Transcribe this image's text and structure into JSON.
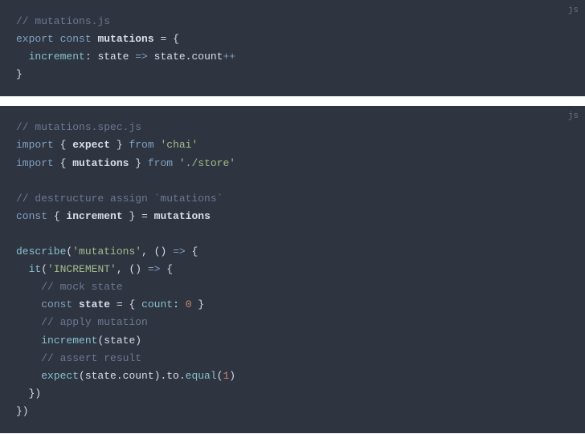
{
  "block1": {
    "lang": "js",
    "lines": {
      "l1_comment": "// mutations.js",
      "l2_export": "export",
      "l2_const": "const",
      "l2_name": "mutations",
      "l2_eq": " = {",
      "l3_prop": "increment",
      "l3_colon": ":",
      "l3_state1": " state ",
      "l3_arrow": "=>",
      "l3_state2": " state.count",
      "l3_op": "++",
      "l4_close": "}"
    }
  },
  "block2": {
    "lang": "js",
    "lines": {
      "l1_comment": "// mutations.spec.js",
      "l2_import": "import",
      "l2_brace1": " { ",
      "l2_expect": "expect",
      "l2_brace2": " } ",
      "l2_from": "from",
      "l2_chai": "'chai'",
      "l3_import": "import",
      "l3_brace1": " { ",
      "l3_mutations": "mutations",
      "l3_brace2": " } ",
      "l3_from": "from",
      "l3_store": "'./store'",
      "l4_empty": "",
      "l5_comment": "// destructure assign `mutations`",
      "l6_const": "const",
      "l6_brace1": " { ",
      "l6_increment": "increment",
      "l6_brace2": " } = ",
      "l6_mutations": "mutations",
      "l7_empty": "",
      "l8_describe": "describe",
      "l8_paren": "(",
      "l8_str": "'mutations'",
      "l8_comma": ", () ",
      "l8_arrow": "=>",
      "l8_brace": " {",
      "l9_it": "it",
      "l9_paren": "(",
      "l9_str": "'INCREMENT'",
      "l9_comma": ", () ",
      "l9_arrow": "=>",
      "l9_brace": " {",
      "l10_comment": "// mock state",
      "l11_const": "const",
      "l11_state": " state ",
      "l11_eq": "= { ",
      "l11_count": "count",
      "l11_colon": ": ",
      "l11_zero": "0",
      "l11_close": " }",
      "l12_comment": "// apply mutation",
      "l13_increment": "increment",
      "l13_paren": "(state)",
      "l14_comment": "// assert result",
      "l15_expect": "expect",
      "l15_args": "(state.count).to.",
      "l15_equal": "equal",
      "l15_paren": "(",
      "l15_one": "1",
      "l15_close": ")",
      "l16_close": "})",
      "l17_close": "})"
    }
  }
}
